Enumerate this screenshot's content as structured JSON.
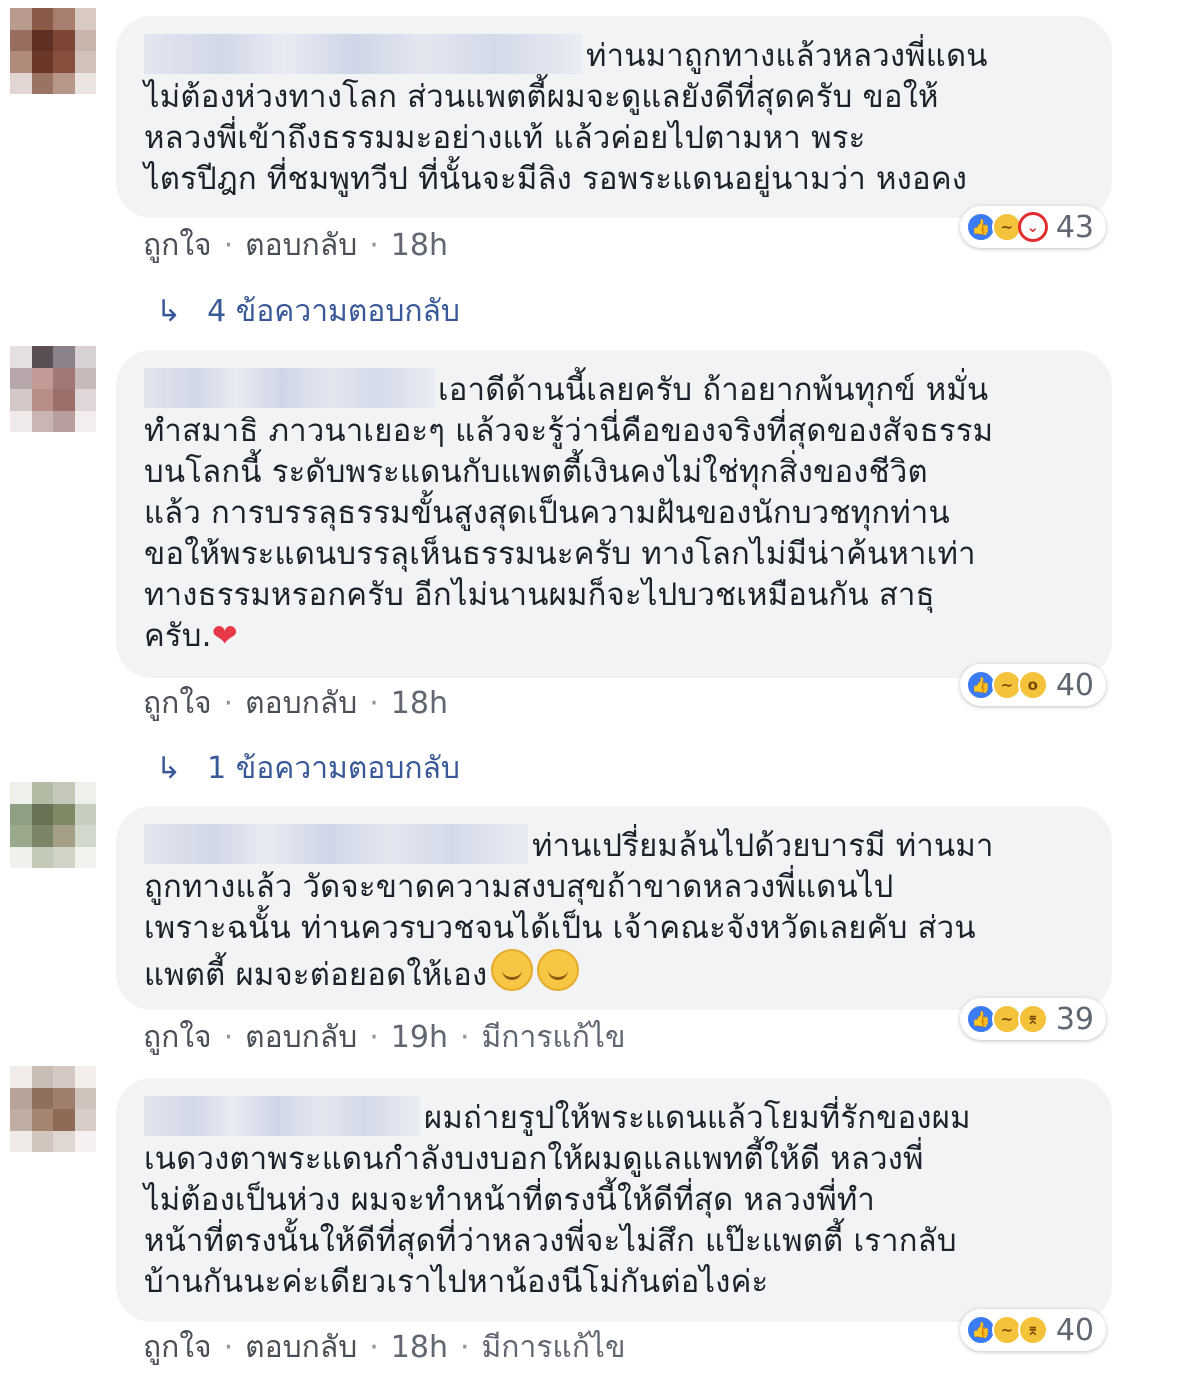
{
  "comments": [
    {
      "lines": [
        "ท่านมาถูกทางแล้วหลวงพี่แดน",
        "ไม่ต้องห่วงทางโลก ส่วนแพตตี้ผมจะดูแลยังดีที่สุดครับ ขอให้",
        "หลวงพี่เข้าถึงธรรมมะอย่างแท้ แล้วค่อยไปตามหา พระ",
        "ไตรปีฎก ที่ชมพูทวีป ที่นั้นจะมีลิง รอพระแดนอยู่นามว่า หงอคง"
      ],
      "reaction_count": "43",
      "reaction_icons": [
        "like-icon",
        "haha-icon",
        "angry-icon"
      ],
      "like": "ถูกใจ",
      "reply": "ตอบกลับ",
      "time": "18h",
      "edited": "",
      "replies_label": "4 ข้อความตอบกลับ"
    },
    {
      "lines": [
        "เอาดีด้านนี้เลยครับ ถ้าอยากพ้นทุกข์ หมั่น",
        "ทำสมาธิ ภาวนาเยอะๆ แล้วจะรู้ว่านี่คือของจริงที่สุดของสัจธรรม",
        "บนโลกนี้ ระดับพระแดนกับแพตตี้เงินคงไม่ใช่ทุกสิ่งของชีวิต",
        "แล้ว การบรรลุธรรมขั้นสูงสุดเป็นความฝันของนักบวชทุกท่าน",
        "ขอให้พระแดนบรรลุเห็นธรรมนะครับ ทางโลกไม่มีน่าค้นหาเท่า",
        "ทางธรรมหรอกครับ อีกไม่นานผมก็จะไปบวชเหมือนกัน สาธุ",
        "ครับ."
      ],
      "reaction_count": "40",
      "reaction_icons": [
        "like-icon",
        "haha-icon",
        "wow-icon"
      ],
      "like": "ถูกใจ",
      "reply": "ตอบกลับ",
      "time": "18h",
      "edited": "",
      "replies_label": "1 ข้อความตอบกลับ"
    },
    {
      "lines": [
        "ท่านเปรี่ยมล้นไปด้วยบารมี ท่านมา",
        "ถูกทางแล้ว วัดจะขาดความสงบสุขถ้าขาดหลวงพี่แดนไป",
        "เพราะฉนั้น ท่านควรบวชจนได้เป็น เจ้าคณะจังหวัดเลยคับ ส่วน",
        "แพตตี้ ผมจะต่อยอดให้เอง"
      ],
      "reaction_count": "39",
      "reaction_icons": [
        "like-icon",
        "haha-icon",
        "sad-icon"
      ],
      "like": "ถูกใจ",
      "reply": "ตอบกลับ",
      "time": "19h",
      "edited": "มีการแก้ไข",
      "replies_label": ""
    },
    {
      "lines": [
        "ผมถ่ายรูปให้พระแดนแล้วโยมที่รักของผม",
        "เนดวงตาพระแดนกำลังบงบอกให้ผมดูแลแพทตี้ให้ดี หลวงพี่",
        "ไม่ต้องเป็นห่วง ผมจะทำหน้าที่ตรงนี้ให้ดีที่สุด หลวงพี่ทำ",
        "หน้าที่ตรงนั้นให้ดีที่สุดที่ว่าหลวงพี่จะไม่สึก แป๊ะแพตตี้ เรากลับ",
        "บ้านกันนะค่ะเดียวเราไปหาน้องนีโม่กันต่อไงค่ะ"
      ],
      "reaction_count": "40",
      "reaction_icons": [
        "like-icon",
        "haha-icon",
        "sad-icon"
      ],
      "like": "ถูกใจ",
      "reply": "ตอบกลับ",
      "time": "18h",
      "edited": "มีการแก้ไข",
      "replies_label": ""
    }
  ],
  "separator": "·",
  "colors": {
    "bubble": "#f2f3f5",
    "link": "#385898",
    "meta": "#606770",
    "like": "#3b7cf5",
    "heart": "#e8394a"
  }
}
